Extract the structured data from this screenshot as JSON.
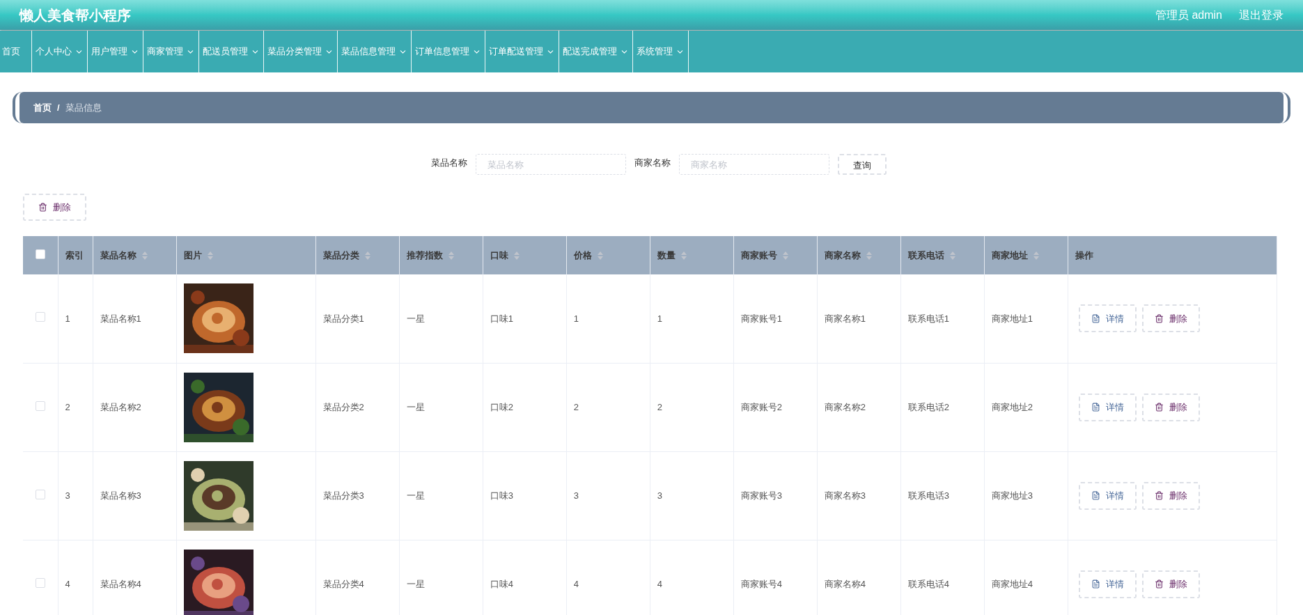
{
  "header": {
    "title": "懒人美食帮小程序",
    "user": "管理员 admin",
    "logout": "退出登录"
  },
  "nav": [
    {
      "label": "首页",
      "dropdown": false
    },
    {
      "label": "个人中心",
      "dropdown": true
    },
    {
      "label": "用户管理",
      "dropdown": true
    },
    {
      "label": "商家管理",
      "dropdown": true
    },
    {
      "label": "配送员管理",
      "dropdown": true
    },
    {
      "label": "菜品分类管理",
      "dropdown": true
    },
    {
      "label": "菜品信息管理",
      "dropdown": true
    },
    {
      "label": "订单信息管理",
      "dropdown": true
    },
    {
      "label": "订单配送管理",
      "dropdown": true
    },
    {
      "label": "配送完成管理",
      "dropdown": true
    },
    {
      "label": "系统管理",
      "dropdown": true
    }
  ],
  "breadcrumb": {
    "items": [
      "首页",
      "菜品信息"
    ],
    "separator": "/"
  },
  "search": {
    "fields": [
      {
        "label": "菜品名称",
        "placeholder": "菜品名称"
      },
      {
        "label": "商家名称",
        "placeholder": "商家名称"
      }
    ],
    "button": "查询"
  },
  "bulk_delete": "删除",
  "table": {
    "select_all": {
      "checked": false
    },
    "columns": [
      {
        "label": "索引",
        "kind": "text",
        "sortable": false
      },
      {
        "label": "菜品名称",
        "kind": "text",
        "sortable": true
      },
      {
        "label": "图片",
        "sortable": true
      },
      {
        "label": "菜品分类",
        "kind": "text",
        "sortable": true
      },
      {
        "label": "推荐指数",
        "kind": "text",
        "sortable": true
      },
      {
        "label": "口味",
        "kind": "text",
        "sortable": true
      },
      {
        "label": "价格",
        "kind": "text",
        "sortable": true
      },
      {
        "label": "数量",
        "kind": "text",
        "sortable": true
      },
      {
        "label": "商家账号",
        "kind": "text",
        "sortable": true
      },
      {
        "label": "商家名称",
        "kind": "text",
        "sortable": true
      },
      {
        "label": "联系电话",
        "kind": "text",
        "sortable": true
      },
      {
        "label": "商家地址",
        "kind": "text",
        "sortable": true
      },
      {
        "label": "操作",
        "kind": "actions",
        "sortable": false
      }
    ],
    "rows": [
      {
        "checked": false,
        "cells": [
          "1",
          "菜品名称1",
          {
            "kind": "picture"
          },
          "菜品分类1",
          "一星",
          "口味1",
          "1",
          "1",
          "商家账号1",
          "商家名称1",
          "联系电话1",
          "商家地址1"
        ],
        "actions": [
          "详情",
          "删除"
        ]
      },
      {
        "checked": false,
        "cells": [
          "2",
          "菜品名称2",
          {
            "kind": "picture"
          },
          "菜品分类2",
          "一星",
          "口味2",
          "2",
          "2",
          "商家账号2",
          "商家名称2",
          "联系电话2",
          "商家地址2"
        ],
        "actions": [
          "详情",
          "删除"
        ]
      },
      {
        "checked": false,
        "cells": [
          "3",
          "菜品名称3",
          {
            "kind": "picture"
          },
          "菜品分类3",
          "一星",
          "口味3",
          "3",
          "3",
          "商家账号3",
          "商家名称3",
          "联系电话3",
          "商家地址3"
        ],
        "actions": [
          "详情",
          "删除"
        ]
      },
      {
        "checked": false,
        "cells": [
          "4",
          "菜品名称4",
          {
            "kind": "picture"
          },
          "菜品分类4",
          "一星",
          "口味4",
          "4",
          "4",
          "商家账号4",
          "商家名称4",
          "联系电话4",
          "商家地址4"
        ],
        "actions": [
          "详情",
          "删除"
        ]
      }
    ]
  }
}
